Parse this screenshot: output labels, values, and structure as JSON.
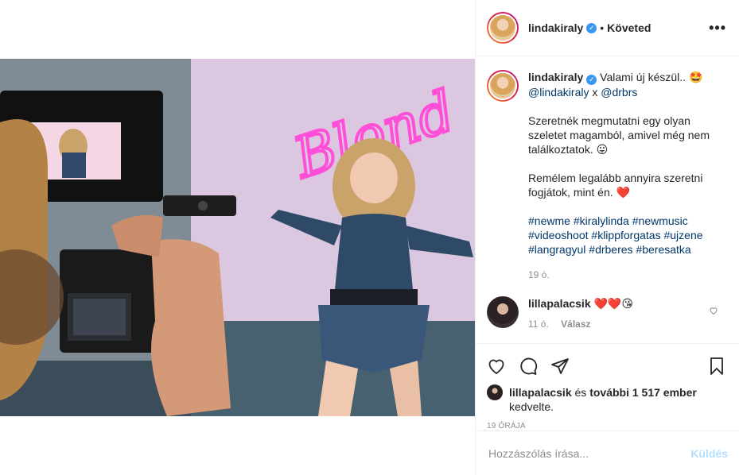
{
  "post": {
    "username": "lindakiraly",
    "follow_status": "Követed",
    "dot": "•",
    "more": "•••"
  },
  "caption": {
    "username": "lindakiraly",
    "line1": "Valami új készül.. 🤩",
    "mention1": "@lindakiraly",
    "x": "x",
    "mention2": "@drbrs",
    "para2": "Szeretnék megmutatni egy olyan szeletet magamból, amivel még nem találkoztatok. 😛",
    "para3": "Remélem legalább annyira szeretni fogjátok, mint én. ❤️",
    "hashtags": [
      "#newme",
      "#kiralylinda",
      "#newmusic",
      "#videoshoot",
      "#klippforgatas",
      "#ujzene",
      "#langragyul",
      "#drberes",
      "#beresatka"
    ],
    "time": "19 ó."
  },
  "comment": {
    "username": "lillapalacsik",
    "text": "❤️❤️😘",
    "time": "11 ó.",
    "reply": "Válasz"
  },
  "likes": {
    "first_user": "lillapalacsik",
    "middle": " és ",
    "others": "további 1 517 ember",
    "end": "kedvelte."
  },
  "posted_time": "19 ÓRÁJA",
  "comment_input": {
    "placeholder": "Hozzászólás írása...",
    "post_label": "Küldés"
  },
  "neon_sign_text": "Blond",
  "colors": {
    "verified": "#3897f0",
    "link": "#00376b",
    "post_disabled": "#b2dffc",
    "neon": "#ff4fd8"
  }
}
